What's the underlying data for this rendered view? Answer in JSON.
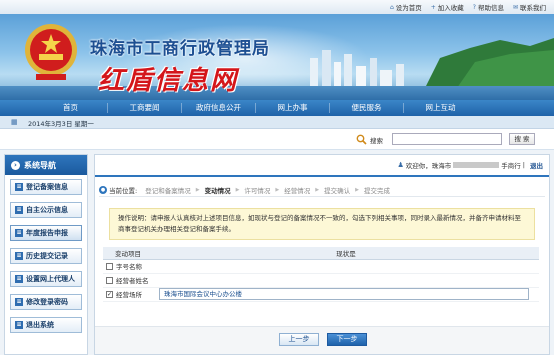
{
  "topbar": {
    "links": [
      {
        "icon": "house-icon",
        "glyph": "⌂",
        "label": "设为首页"
      },
      {
        "icon": "plus-icon",
        "glyph": "+",
        "label": "加入收藏"
      },
      {
        "icon": "help-icon",
        "glyph": "?",
        "label": "帮助信息"
      },
      {
        "icon": "mail-icon",
        "glyph": "✉",
        "label": "联系我们"
      }
    ]
  },
  "banner": {
    "org_title": "珠海市工商行政管理局",
    "brand": "红盾信息网"
  },
  "nav": {
    "items": [
      "首页",
      "工商要闻",
      "政府信息公开",
      "网上办事",
      "便民服务",
      "网上互动"
    ]
  },
  "datebar": {
    "date_text": "2014年3月3日 星期一"
  },
  "search": {
    "label": "搜索",
    "button": "搜 索"
  },
  "sidebar": {
    "title": "系统导航",
    "items": [
      {
        "label": "登记备案信息",
        "active": false
      },
      {
        "label": "自主公示信息",
        "active": false
      },
      {
        "label": "年度报告申报",
        "active": true
      },
      {
        "label": "历史提交记录",
        "active": false
      },
      {
        "label": "设置网上代理人",
        "active": false
      },
      {
        "label": "修改登录密码",
        "active": false
      },
      {
        "label": "退出系统",
        "active": false
      }
    ]
  },
  "header": {
    "welcome_prefix": "欢迎你，珠海市",
    "welcome_suffix": "手商行",
    "exit_label": "退出"
  },
  "steps": {
    "location_label": "当前位置:",
    "items": [
      {
        "label": "登记和备案情况",
        "current": false
      },
      {
        "label": "变动情况",
        "current": true
      },
      {
        "label": "许可情况",
        "current": false
      },
      {
        "label": "经营情况",
        "current": false
      },
      {
        "label": "提交确认",
        "current": false
      },
      {
        "label": "提交完成",
        "current": false
      }
    ]
  },
  "instructions": {
    "label": "操作说明",
    "text": "请申报人认真核对上述项目信息，如现状与登记的备案情况不一致的，勾选下列相关事项，同时录入最新情况，并备齐申请材料至商事登记机关办理相关登记和备案手续。"
  },
  "table": {
    "headers": [
      "变动项目",
      "现状是"
    ],
    "rows": [
      {
        "label": "字号名称",
        "checked": false,
        "value": ""
      },
      {
        "label": "经营者姓名",
        "checked": false,
        "value": ""
      },
      {
        "label": "经营场所",
        "checked": true,
        "value": "珠海市国际会议中心办公楼"
      }
    ]
  },
  "buttons": {
    "prev": "上一步",
    "next": "下一步"
  }
}
